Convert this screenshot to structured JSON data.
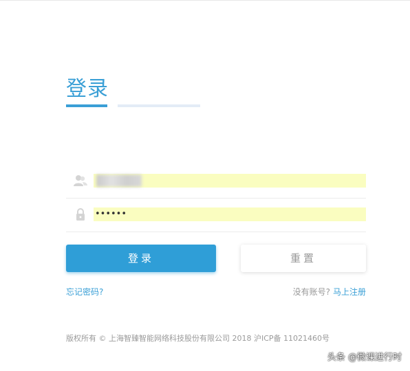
{
  "title": "登录",
  "form": {
    "password_mask": "••••••"
  },
  "buttons": {
    "login": "登录",
    "reset": "重置"
  },
  "links": {
    "forgot_password": "忘记密码?",
    "no_account": "没有账号?",
    "register": "马上注册"
  },
  "footer": {
    "copyright": "版权所有 © 上海智臻智能网络科技股份有限公司 2018 沪ICP备 11021460号"
  },
  "watermark": "头条 @微课进行时",
  "icons": {
    "user": "user-icon",
    "lock": "lock-icon"
  },
  "colors": {
    "accent": "#3a9fd6",
    "autofill": "#fafdc0"
  }
}
